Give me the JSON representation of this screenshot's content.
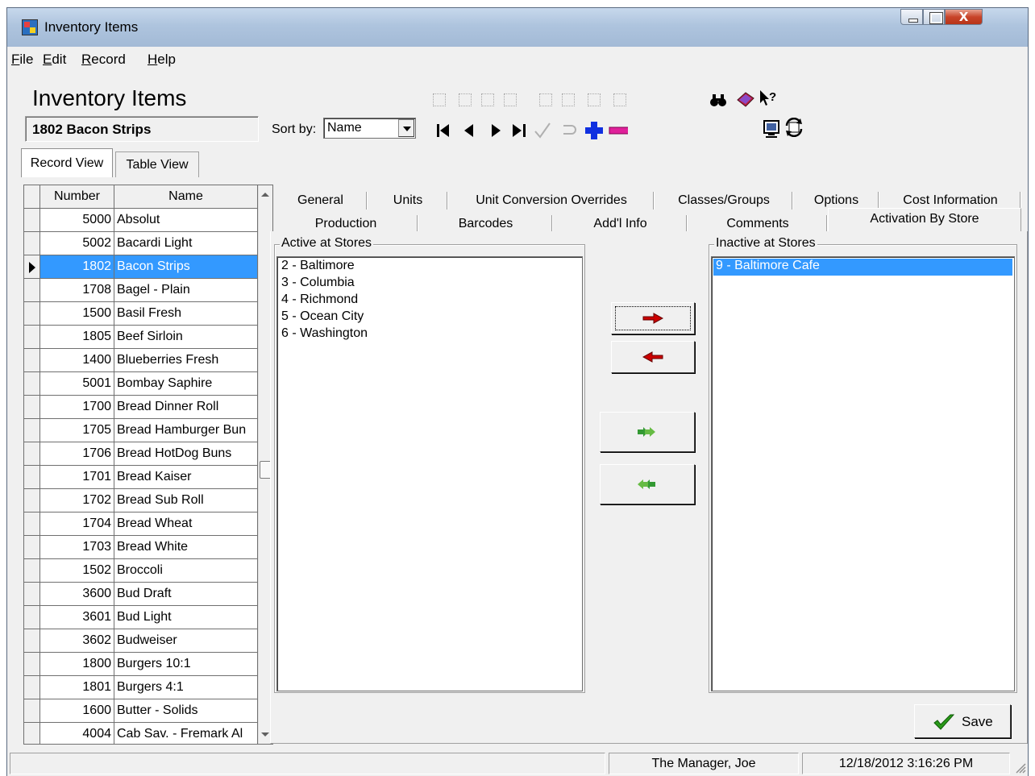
{
  "window": {
    "title": "Inventory Items"
  },
  "menu": [
    {
      "label_acc": "F",
      "label_rest": "ile"
    },
    {
      "label_acc": "E",
      "label_rest": "dit"
    },
    {
      "label_acc": "R",
      "label_rest": "ecord"
    },
    {
      "label_acc": "H",
      "label_rest": "elp"
    }
  ],
  "header": {
    "title": "Inventory Items",
    "current_record": "1802 Bacon Strips",
    "sort_label": "Sort by:",
    "sort_value": "Name"
  },
  "view_tabs": [
    "Record View",
    "Table View"
  ],
  "grid": {
    "columns": [
      "Number",
      "Name"
    ],
    "selected_index": 2,
    "rows": [
      {
        "number": "5000",
        "name": "Absolut"
      },
      {
        "number": "5002",
        "name": "Bacardi Light"
      },
      {
        "number": "1802",
        "name": "Bacon Strips"
      },
      {
        "number": "1708",
        "name": "Bagel - Plain"
      },
      {
        "number": "1500",
        "name": "Basil Fresh"
      },
      {
        "number": "1805",
        "name": "Beef Sirloin"
      },
      {
        "number": "1400",
        "name": "Blueberries Fresh"
      },
      {
        "number": "5001",
        "name": "Bombay Saphire"
      },
      {
        "number": "1700",
        "name": "Bread Dinner Roll"
      },
      {
        "number": "1705",
        "name": "Bread Hamburger Bun"
      },
      {
        "number": "1706",
        "name": "Bread HotDog Buns"
      },
      {
        "number": "1701",
        "name": "Bread Kaiser"
      },
      {
        "number": "1702",
        "name": "Bread Sub Roll"
      },
      {
        "number": "1704",
        "name": "Bread Wheat"
      },
      {
        "number": "1703",
        "name": "Bread White"
      },
      {
        "number": "1502",
        "name": "Broccoli"
      },
      {
        "number": "3600",
        "name": "Bud Draft"
      },
      {
        "number": "3601",
        "name": "Bud Light"
      },
      {
        "number": "3602",
        "name": "Budweiser"
      },
      {
        "number": "1800",
        "name": "Burgers 10:1"
      },
      {
        "number": "1801",
        "name": "Burgers 4:1"
      },
      {
        "number": "1600",
        "name": "Butter - Solids"
      },
      {
        "number": "4004",
        "name": "Cab Sav. - Fremark Al"
      }
    ]
  },
  "tabs_row1": [
    "General",
    "Units",
    "Unit Conversion Overrides",
    "Classes/Groups",
    "Options",
    "Cost Information"
  ],
  "tabs_row2": [
    "Production",
    "Barcodes",
    "Add'l Info",
    "Comments",
    "Activation By Store"
  ],
  "active_tab": "Activation By Store",
  "active_stores": {
    "label": "Active at Stores",
    "items": [
      "2 - Baltimore",
      "3 - Columbia",
      "4 - Richmond",
      "5 - Ocean City",
      "6 - Washington"
    ]
  },
  "inactive_stores": {
    "label": "Inactive at Stores",
    "items": [
      "9 - Baltimore Cafe"
    ],
    "selected_index": 0
  },
  "buttons": {
    "save": "Save"
  },
  "status": {
    "user": "The Manager, Joe",
    "datetime": "12/18/2012 3:16:26 PM"
  },
  "colors": {
    "selection": "#3399ff",
    "move_arrow": "#cc0000",
    "move_all_arrow": "#339933",
    "add_icon": "#1030e0",
    "remove_icon": "#e0209a"
  }
}
